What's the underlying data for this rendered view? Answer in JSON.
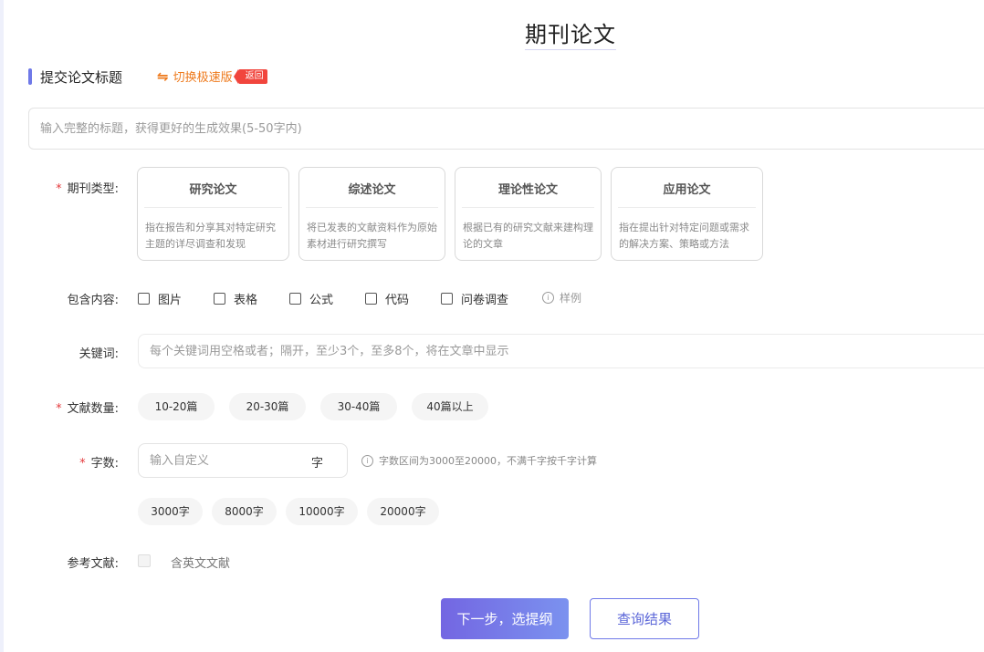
{
  "page": {
    "title": "期刊论文"
  },
  "section": {
    "title": "提交论文标题",
    "switch_label": "切换极速版",
    "back_badge": "返回"
  },
  "title_input": {
    "placeholder": "输入完整的标题，获得更好的生成效果(5-50字内)",
    "value": ""
  },
  "journal_type": {
    "label": "期刊类型:",
    "required": "*",
    "cards": [
      {
        "title": "研究论文",
        "desc": "指在报告和分享其对特定研究主题的详尽调查和发现"
      },
      {
        "title": "综述论文",
        "desc": "将已发表的文献资料作为原始素材进行研究撰写"
      },
      {
        "title": "理论性论文",
        "desc": "根据已有的研究文献来建构理论的文章"
      },
      {
        "title": "应用论文",
        "desc": "指在提出针对特定问题或需求的解决方案、策略或方法"
      }
    ]
  },
  "include": {
    "label": "包含内容:",
    "options": [
      "图片",
      "表格",
      "公式",
      "代码",
      "问卷调查"
    ],
    "sample": "样例"
  },
  "keywords": {
    "label": "关键词:",
    "placeholder": "每个关键词用空格或者；隔开，至少3个，至多8个，将在文章中显示",
    "value": ""
  },
  "ref_count": {
    "label": "文献数量:",
    "required": "*",
    "options": [
      "10-20篇",
      "20-30篇",
      "30-40篇",
      "40篇以上"
    ]
  },
  "word_count": {
    "label": "字数:",
    "required": "*",
    "placeholder": "输入自定义",
    "value": "",
    "unit": "字",
    "hint": "字数区间为3000至20000，不满千字按千字计算",
    "presets": [
      "3000字",
      "8000字",
      "10000字",
      "20000字"
    ]
  },
  "references": {
    "label": "参考文献:",
    "option": "含英文文献"
  },
  "buttons": {
    "next": "下一步，选提纲",
    "query": "查询结果"
  },
  "icons": {
    "switch": "swap-arrows-icon",
    "info": "info-icon"
  },
  "colors": {
    "accent": "#6f79e8",
    "switch": "#ee7a1d",
    "badge": "#f1453d",
    "required": "#e4393c"
  }
}
